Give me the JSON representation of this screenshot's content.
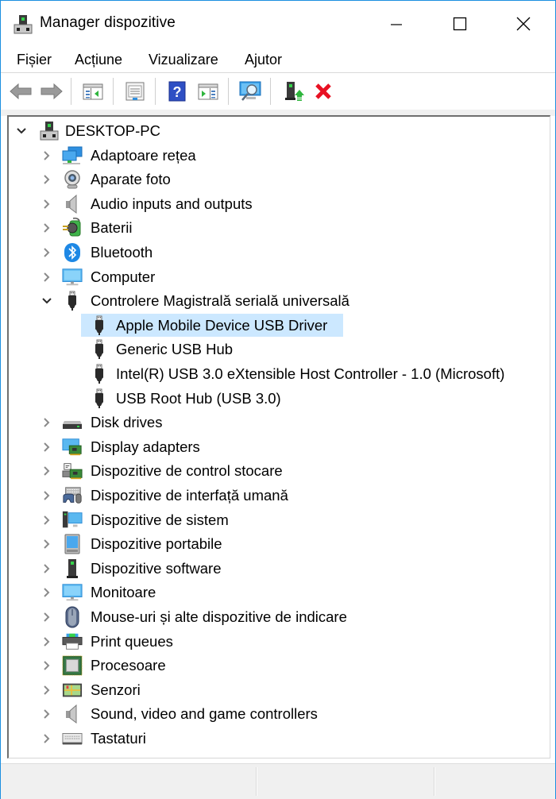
{
  "window": {
    "title": "Manager dispozitive",
    "controls": {
      "minimize": "minimize",
      "maximize": "maximize",
      "close": "close"
    },
    "accent_color": "#1c8fe0"
  },
  "menu": [
    {
      "label": "Fișier"
    },
    {
      "label": "Acțiune"
    },
    {
      "label": "Vizualizare"
    },
    {
      "label": "Ajutor"
    }
  ],
  "toolbar": [
    {
      "icon": "back-arrow-icon",
      "tooltip": "Back"
    },
    {
      "icon": "forward-arrow-icon",
      "tooltip": "Forward"
    },
    {
      "icon": "show-hide-console-tree-icon"
    },
    {
      "icon": "properties-icon"
    },
    {
      "icon": "help-icon"
    },
    {
      "icon": "show-action-pane-icon"
    },
    {
      "icon": "scan-hardware-changes-icon"
    },
    {
      "icon": "update-driver-icon"
    },
    {
      "icon": "uninstall-device-icon"
    }
  ],
  "tree": {
    "root": {
      "label": "DESKTOP-PC",
      "expanded": true,
      "icon": "computer-tower-icon"
    },
    "categories": [
      {
        "label": "Adaptoare rețea",
        "icon": "network-adapter-icon",
        "expanded": false
      },
      {
        "label": "Aparate foto",
        "icon": "camera-icon",
        "expanded": false
      },
      {
        "label": "Audio inputs and outputs",
        "icon": "speaker-icon",
        "expanded": false
      },
      {
        "label": "Baterii",
        "icon": "battery-icon",
        "expanded": false
      },
      {
        "label": "Bluetooth",
        "icon": "bluetooth-icon",
        "expanded": false
      },
      {
        "label": "Computer",
        "icon": "monitor-icon",
        "expanded": false
      },
      {
        "label": "Controlere Magistrală serială universală",
        "icon": "usb-icon",
        "expanded": true,
        "children": [
          {
            "label": "Apple Mobile Device USB Driver",
            "icon": "usb-icon",
            "selected": true
          },
          {
            "label": "Generic USB Hub",
            "icon": "usb-icon"
          },
          {
            "label": "Intel(R) USB 3.0 eXtensible Host Controller - 1.0 (Microsoft)",
            "icon": "usb-icon"
          },
          {
            "label": "USB Root Hub (USB 3.0)",
            "icon": "usb-icon"
          }
        ]
      },
      {
        "label": "Disk drives",
        "icon": "disk-drive-icon",
        "expanded": false
      },
      {
        "label": "Display adapters",
        "icon": "display-adapter-icon",
        "expanded": false
      },
      {
        "label": "Dispozitive de control stocare",
        "icon": "storage-controller-icon",
        "expanded": false
      },
      {
        "label": "Dispozitive de interfață umană",
        "icon": "hid-icon",
        "expanded": false
      },
      {
        "label": "Dispozitive de sistem",
        "icon": "system-device-icon",
        "expanded": false
      },
      {
        "label": "Dispozitive portabile",
        "icon": "portable-device-icon",
        "expanded": false
      },
      {
        "label": "Dispozitive software",
        "icon": "software-device-icon",
        "expanded": false
      },
      {
        "label": "Monitoare",
        "icon": "monitor-icon",
        "expanded": false
      },
      {
        "label": "Mouse-uri și alte dispozitive de indicare",
        "icon": "mouse-icon",
        "expanded": false
      },
      {
        "label": "Print queues",
        "icon": "printer-icon",
        "expanded": false
      },
      {
        "label": "Procesoare",
        "icon": "processor-icon",
        "expanded": false
      },
      {
        "label": "Senzori",
        "icon": "sensor-icon",
        "expanded": false
      },
      {
        "label": "Sound, video and game controllers",
        "icon": "speaker-icon",
        "expanded": false
      },
      {
        "label": "Tastaturi",
        "icon": "keyboard-icon",
        "expanded": false
      }
    ]
  },
  "colors": {
    "selection": "#cce8ff",
    "uninstall_red": "#e81123"
  }
}
